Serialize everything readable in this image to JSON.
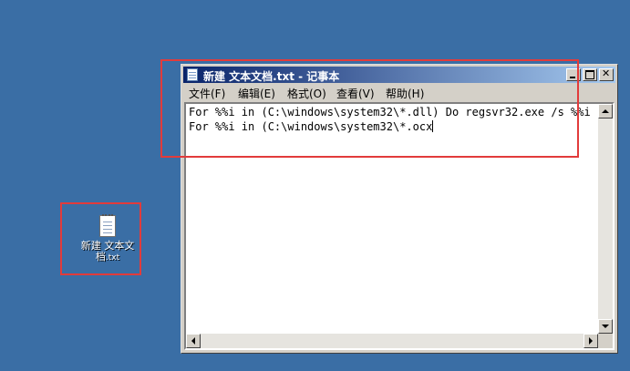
{
  "desktop": {
    "icon": {
      "name": "text-file-icon",
      "label_line1": "新建 文本文",
      "label_line2": "档",
      "label_ext": ".txt"
    }
  },
  "notepad": {
    "title": "新建 文本文档.txt - 记事本",
    "menu": [
      {
        "label": "文件(F)"
      },
      {
        "label": "编辑(E)"
      },
      {
        "label": "格式(O)"
      },
      {
        "label": "查看(V)"
      },
      {
        "label": "帮助(H)"
      }
    ],
    "lines": [
      "For %%i in (C:\\windows\\system32\\*.dll) Do regsvr32.exe /s %%i",
      "For %%i in (C:\\windows\\system32\\*.ocx"
    ]
  },
  "colors": {
    "desktop": "#3a6ea5",
    "highlight_box": "#e23b3b",
    "titlebar_start": "#0a246a",
    "titlebar_end": "#a6caf0"
  }
}
